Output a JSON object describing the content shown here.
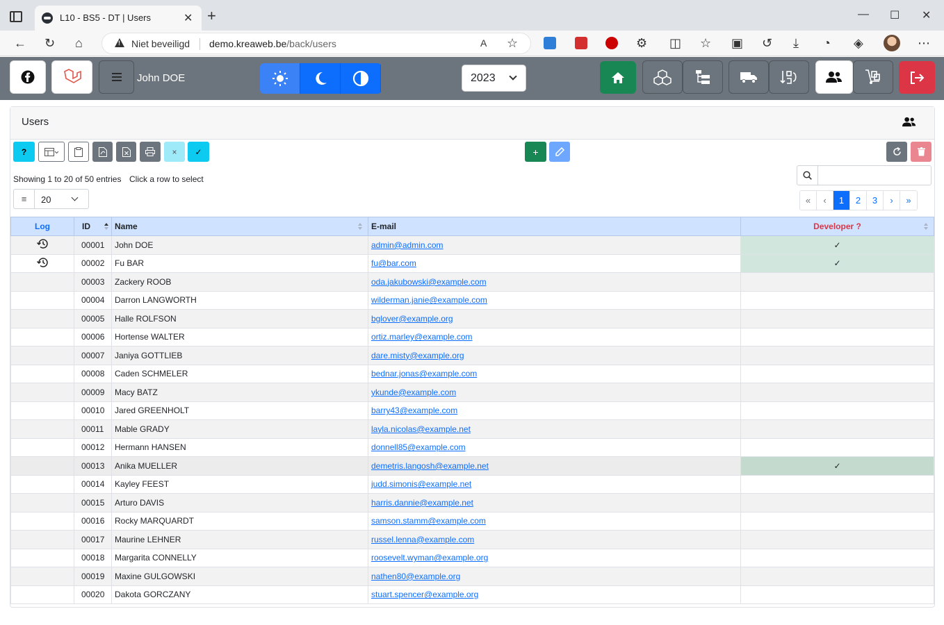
{
  "browser": {
    "tab_title": "L10 - BS5 - DT | Users",
    "tab_close": "✕",
    "new_tab": "+",
    "security_label": "Niet beveiligd",
    "url_host": "demo.kreaweb.be",
    "url_path": "/back/users",
    "minimize": "—",
    "maximize": "☐",
    "close": "✕"
  },
  "navbar": {
    "user_name": "John DOE",
    "year": "2023"
  },
  "card": {
    "title": "Users"
  },
  "toolbar": {
    "help": "?",
    "add": "+",
    "deselect": "×",
    "select": "✓"
  },
  "table_info": {
    "showing": "Showing 1 to 20 of 50 entries",
    "hint": "Click a row to select"
  },
  "page_length": "20",
  "pager": {
    "first": "«",
    "prev": "‹",
    "pages": [
      "1",
      "2",
      "3"
    ],
    "next": "›",
    "last": "»"
  },
  "columns": {
    "log": "Log",
    "id": "ID",
    "name": "Name",
    "email": "E-mail",
    "developer": "Developer ?"
  },
  "colors": {
    "header_bg": "#cfe2ff",
    "developer_header": "#dc3545",
    "log_header": "#0d6efd",
    "developer_bg": "#d1e7dd"
  },
  "rows": [
    {
      "log": true,
      "id": "00001",
      "name": "John DOE",
      "email": "admin@admin.com",
      "developer": true
    },
    {
      "log": true,
      "id": "00002",
      "name": "Fu BAR",
      "email": "fu@bar.com",
      "developer": true
    },
    {
      "log": false,
      "id": "00003",
      "name": "Zackery ROOB",
      "email": "oda.jakubowski@example.com",
      "developer": false
    },
    {
      "log": false,
      "id": "00004",
      "name": "Darron LANGWORTH",
      "email": "wilderman.janie@example.com",
      "developer": false
    },
    {
      "log": false,
      "id": "00005",
      "name": "Halle ROLFSON",
      "email": "bglover@example.org",
      "developer": false
    },
    {
      "log": false,
      "id": "00006",
      "name": "Hortense WALTER",
      "email": "ortiz.marley@example.com",
      "developer": false
    },
    {
      "log": false,
      "id": "00007",
      "name": "Janiya GOTTLIEB",
      "email": "dare.misty@example.org",
      "developer": false
    },
    {
      "log": false,
      "id": "00008",
      "name": "Caden SCHMELER",
      "email": "bednar.jonas@example.com",
      "developer": false
    },
    {
      "log": false,
      "id": "00009",
      "name": "Macy BATZ",
      "email": "ykunde@example.com",
      "developer": false
    },
    {
      "log": false,
      "id": "00010",
      "name": "Jared GREENHOLT",
      "email": "barry43@example.com",
      "developer": false
    },
    {
      "log": false,
      "id": "00011",
      "name": "Mable GRADY",
      "email": "layla.nicolas@example.net",
      "developer": false
    },
    {
      "log": false,
      "id": "00012",
      "name": "Hermann HANSEN",
      "email": "donnell85@example.com",
      "developer": false
    },
    {
      "log": false,
      "id": "00013",
      "name": "Anika MUELLER",
      "email": "demetris.langosh@example.net",
      "developer": true
    },
    {
      "log": false,
      "id": "00014",
      "name": "Kayley FEEST",
      "email": "judd.simonis@example.net",
      "developer": false
    },
    {
      "log": false,
      "id": "00015",
      "name": "Arturo DAVIS",
      "email": "harris.dannie@example.net",
      "developer": false
    },
    {
      "log": false,
      "id": "00016",
      "name": "Rocky MARQUARDT",
      "email": "samson.stamm@example.com",
      "developer": false
    },
    {
      "log": false,
      "id": "00017",
      "name": "Maurine LEHNER",
      "email": "russel.lenna@example.com",
      "developer": false
    },
    {
      "log": false,
      "id": "00018",
      "name": "Margarita CONNELLY",
      "email": "roosevelt.wyman@example.org",
      "developer": false
    },
    {
      "log": false,
      "id": "00019",
      "name": "Maxine GULGOWSKI",
      "email": "nathen80@example.org",
      "developer": false
    },
    {
      "log": false,
      "id": "00020",
      "name": "Dakota GORCZANY",
      "email": "stuart.spencer@example.org",
      "developer": false
    }
  ],
  "check_mark": "✓"
}
